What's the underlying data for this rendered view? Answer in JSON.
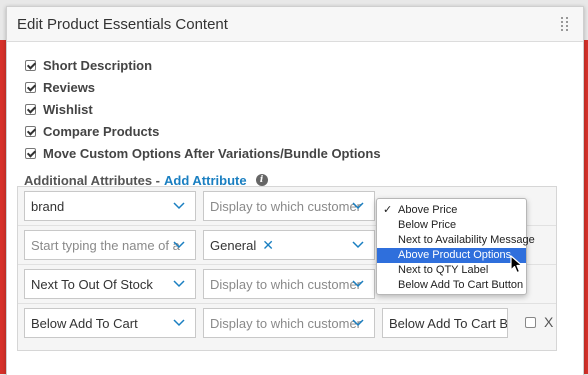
{
  "panel": {
    "title": "Edit Product Essentials Content"
  },
  "options": [
    {
      "label": "Short Description",
      "checked": true
    },
    {
      "label": "Reviews",
      "checked": true
    },
    {
      "label": "Wishlist",
      "checked": true
    },
    {
      "label": "Compare Products",
      "checked": true
    },
    {
      "label": "Move Custom Options After Variations/Bundle Options",
      "checked": true
    }
  ],
  "attributes": {
    "heading": "Additional Attributes -",
    "add_link": "Add Attribute",
    "rows": [
      {
        "attribute": "brand",
        "display": "Display to which customer",
        "position": ""
      },
      {
        "attribute_placeholder": "Start typing the name of a",
        "group_tag": "General",
        "position": ""
      },
      {
        "attribute": "Next To Out Of Stock",
        "display": "Display to which customer",
        "position": ""
      },
      {
        "attribute": "Below Add To Cart",
        "display": "Display to which customer",
        "position": "Below Add To Cart Bu"
      }
    ],
    "delete_label": "X"
  },
  "position_dropdown": {
    "items": [
      "Above Price",
      "Below Price",
      "Next to Availability Message",
      "Above Product Options",
      "Next to QTY Label",
      "Below Add To Cart Button"
    ],
    "checked_index": 0,
    "highlighted_index": 3
  },
  "colors": {
    "accent": "#1a7fc1",
    "highlight": "#2f6fdc",
    "background_edge": "#d6312a"
  }
}
